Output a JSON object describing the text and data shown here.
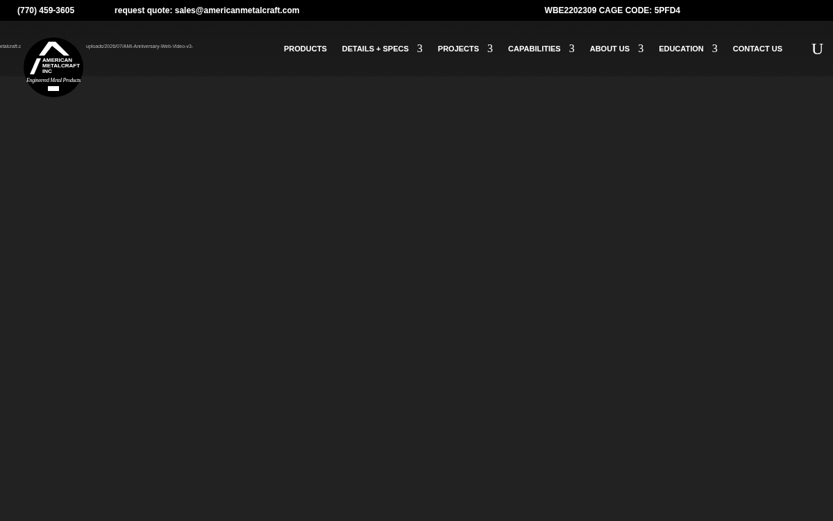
{
  "top_bar": {
    "phone": "(770) 459-3605",
    "quote": "request quote: sales@americanmetalcraft.com",
    "codes": "WBE2202309 CAGE CODE: 5PFD4"
  },
  "broken_media_text": [
    "etalcraft.c",
    "uploads/2026/07/AMI-Anniversary-Web-Video-v3-"
  ],
  "logo": {
    "name_lines": [
      "AMERICAN",
      "METALCRAFT",
      "INC"
    ],
    "tagline": "Engineered Metal Products"
  },
  "nav": [
    {
      "label": "PRODUCTS"
    },
    {
      "label": "DETAILS + SPECS",
      "caret": "3"
    },
    {
      "label": "PROJECTS",
      "caret": "3"
    },
    {
      "label": "CAPABILITIES",
      "caret": "3"
    },
    {
      "label": "ABOUT US",
      "caret": "3"
    },
    {
      "label": "EDUCATION",
      "caret": "3"
    },
    {
      "label": "CONTACT US"
    }
  ],
  "search_glyph": "U"
}
